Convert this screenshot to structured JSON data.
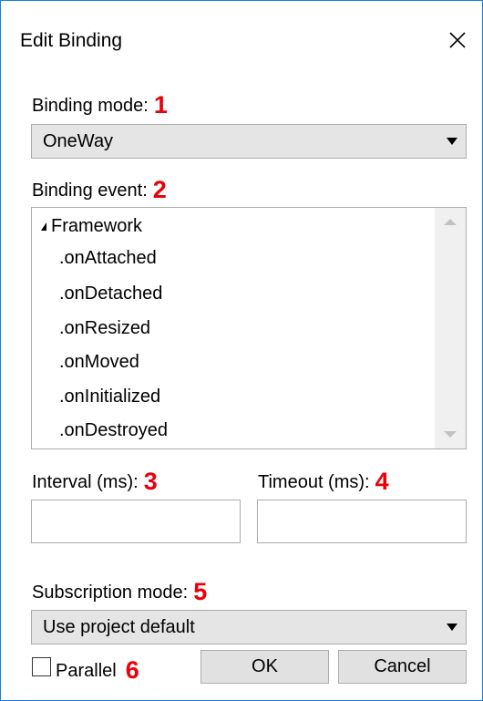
{
  "dialog": {
    "title": "Edit Binding",
    "close_icon": "close-icon"
  },
  "binding_mode": {
    "label": "Binding mode:",
    "marker": "1",
    "value": "OneWay"
  },
  "binding_event": {
    "label": "Binding event:",
    "marker": "2",
    "group": "Framework",
    "items": [
      ".onAttached",
      ".onDetached",
      ".onResized",
      ".onMoved",
      ".onInitialized",
      ".onDestroyed"
    ]
  },
  "interval": {
    "label": "Interval (ms):",
    "marker": "3",
    "value": ""
  },
  "timeout": {
    "label": "Timeout (ms):",
    "marker": "4",
    "value": ""
  },
  "subscription_mode": {
    "label": "Subscription mode:",
    "marker": "5",
    "value": "Use project default"
  },
  "parallel": {
    "label": "Parallel",
    "marker": "6",
    "checked": false
  },
  "buttons": {
    "ok": "OK",
    "cancel": "Cancel"
  },
  "colors": {
    "accent_border": "#1a7fd6",
    "marker": "#e8000b",
    "control_bg": "#e5e5e5"
  }
}
